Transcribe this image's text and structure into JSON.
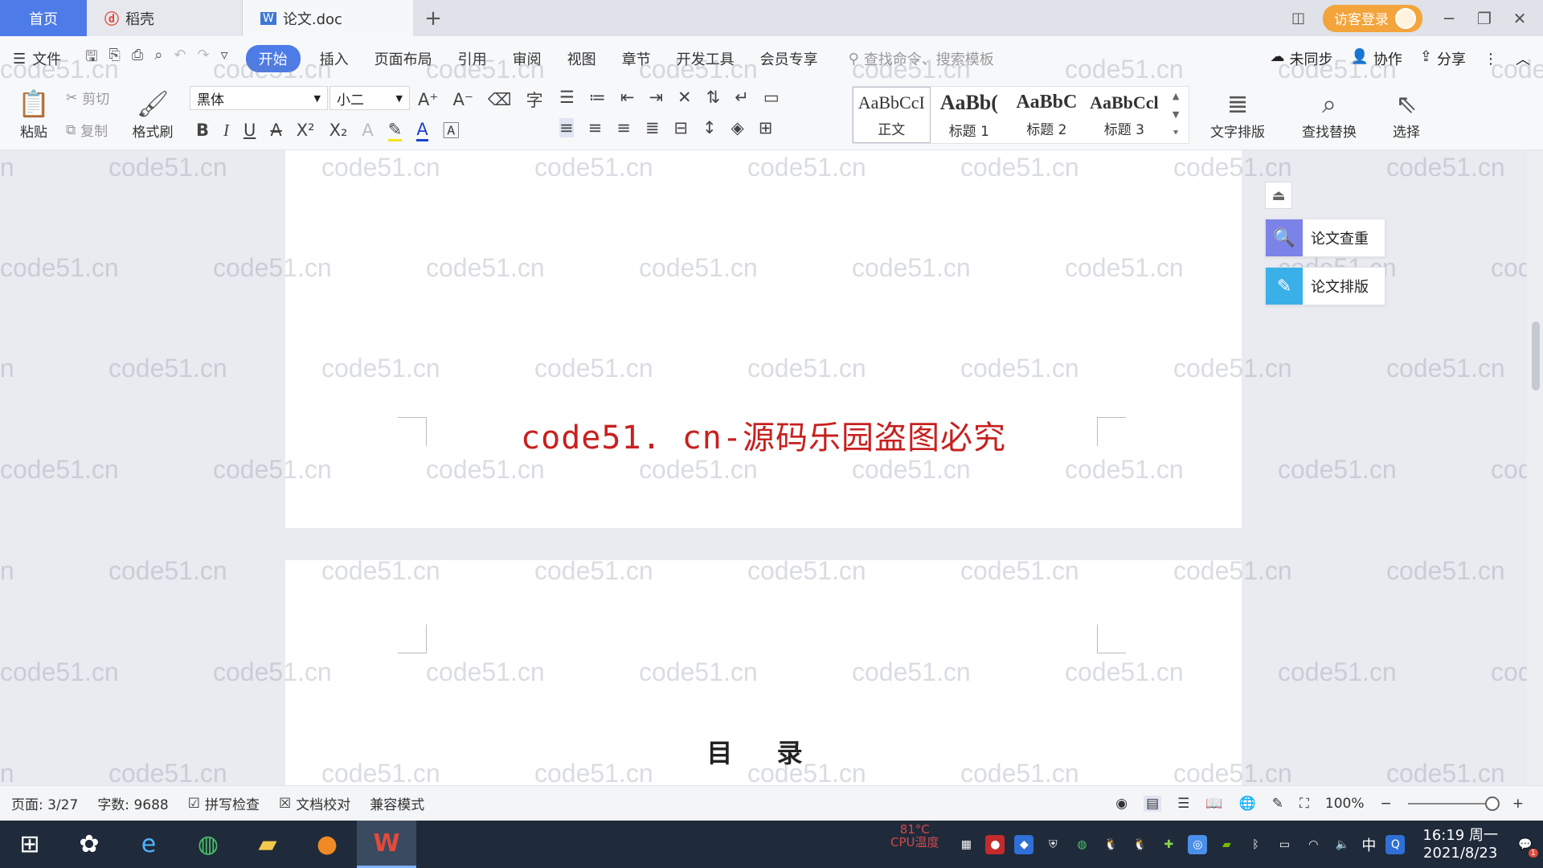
{
  "tabs": {
    "home": "首页",
    "daoke": "稻壳",
    "doc": "论文.doc",
    "add": "+",
    "login": "访客登录"
  },
  "menu": {
    "file": "文件",
    "items": [
      "开始",
      "插入",
      "页面布局",
      "引用",
      "审阅",
      "视图",
      "章节",
      "开发工具",
      "会员专享"
    ],
    "search_placeholder": "查找命令、搜索模板",
    "sync": "未同步",
    "collab": "协作",
    "share": "分享"
  },
  "ribbon": {
    "paste": "粘贴",
    "cut": "剪切",
    "copy": "复制",
    "format_painter": "格式刷",
    "font_name": "黑体",
    "font_size": "小二",
    "styles": [
      {
        "sample": "AaBbCcI",
        "label": "正文"
      },
      {
        "sample": "AaBb(",
        "label": "标题 1"
      },
      {
        "sample": "AaBbC",
        "label": "标题 2"
      },
      {
        "sample": "AaBbCcl",
        "label": "标题 3"
      }
    ],
    "text_layout": "文字排版",
    "find_replace": "查找替换",
    "select": "选择"
  },
  "document": {
    "banner": "code51. cn-源码乐园盗图必究",
    "toc_title": "目 录"
  },
  "watermark": "code51.cn",
  "side_tools": {
    "check": "论文查重",
    "layout": "论文排版"
  },
  "status": {
    "page": "页面: 3/27",
    "words": "字数: 9688",
    "spell": "拼写检查",
    "proof": "文档校对",
    "compat": "兼容模式",
    "zoom": "100%"
  },
  "taskbar": {
    "cpu_temp": "81°C",
    "cpu_label": "CPU温度",
    "ime": "中",
    "time": "16:19 周一",
    "date": "2021/8/23",
    "notif": "1"
  },
  "colors": {
    "accent": "#4d7be7",
    "banner": "#c8201f",
    "login": "#f3a43b"
  }
}
